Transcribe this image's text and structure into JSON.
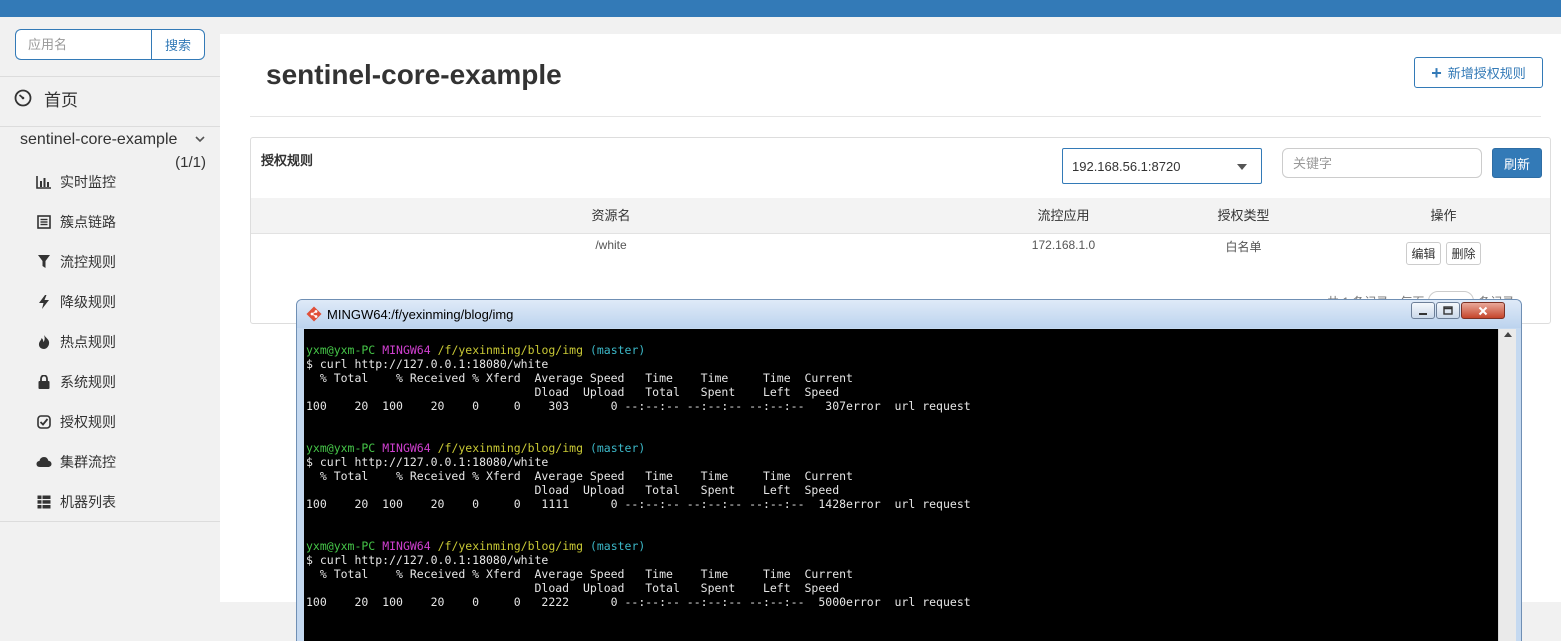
{
  "sidebar": {
    "search_placeholder": "应用名",
    "search_button": "搜索",
    "home_label": "首页",
    "app": {
      "name": "sentinel-core-example",
      "count": "(1/1)"
    },
    "menu": [
      {
        "label": "实时监控",
        "icon": "bar-chart-icon"
      },
      {
        "label": "簇点链路",
        "icon": "list-icon"
      },
      {
        "label": "流控规则",
        "icon": "filter-icon"
      },
      {
        "label": "降级规则",
        "icon": "lightning-icon"
      },
      {
        "label": "热点规则",
        "icon": "fire-icon"
      },
      {
        "label": "系统规则",
        "icon": "lock-icon"
      },
      {
        "label": "授权规则",
        "icon": "check-square-icon"
      },
      {
        "label": "集群流控",
        "icon": "cloud-icon"
      },
      {
        "label": "机器列表",
        "icon": "th-list-icon"
      }
    ]
  },
  "main": {
    "title": "sentinel-core-example",
    "add_button": "新增授权规则",
    "panel_title": "授权规则",
    "machine": "192.168.56.1:8720",
    "keyword_placeholder": "关键字",
    "refresh": "刷新",
    "columns": [
      "资源名",
      "流控应用",
      "授权类型",
      "操作"
    ],
    "rows": [
      {
        "resource": "/white",
        "app": "172.168.1.0",
        "type": "白名单",
        "edit": "编辑",
        "delete": "删除"
      }
    ],
    "pager": {
      "left": "共 1 条记录，每页",
      "right": "条记录"
    }
  },
  "terminal": {
    "title": "MINGW64:/f/yexinming/blog/img",
    "prompt_user": "yxm@yxm-PC",
    "prompt_shell": "MINGW64",
    "prompt_path": "/f/yexinming/blog/img",
    "prompt_branch": "(master)",
    "command": "$ curl http://127.0.0.1:18080/white",
    "header1": "  % Total    % Received % Xferd  Average Speed   Time    Time     Time  Current",
    "header2": "                                 Dload  Upload   Total   Spent    Left  Speed",
    "results": [
      "100    20  100    20    0     0    303      0 --:--:-- --:--:-- --:--:--   307error  url request",
      "100    20  100    20    0     0   1111      0 --:--:-- --:--:-- --:--:--  1428error  url request",
      "100    20  100    20    0     0   2222      0 --:--:-- --:--:-- --:--:--  5000error  url request"
    ]
  },
  "colors": {
    "primary": "#337ab7",
    "terminal_bg": "#000000"
  }
}
